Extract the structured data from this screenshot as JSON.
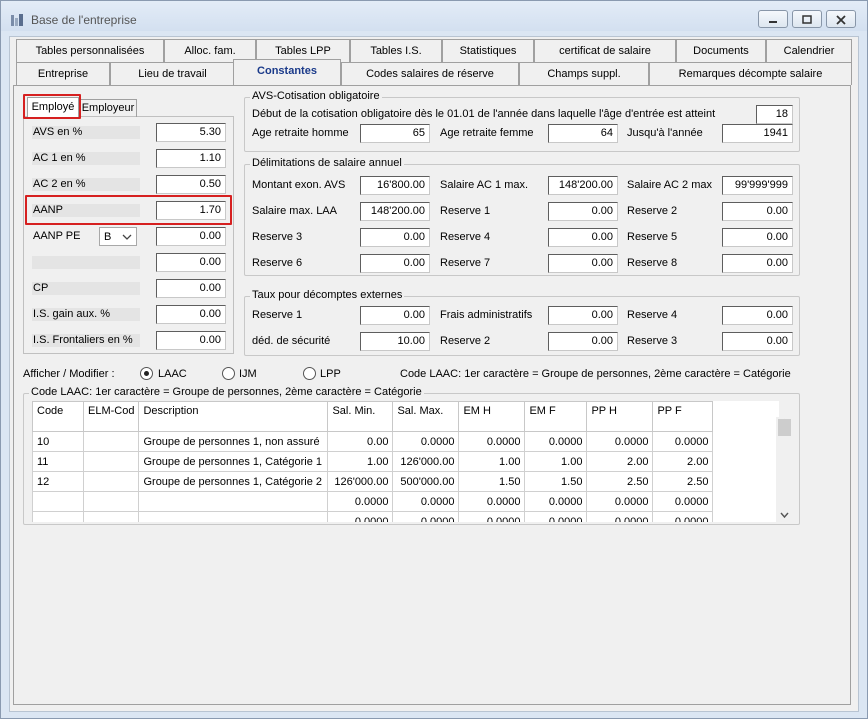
{
  "window": {
    "title": "Base de l'entreprise"
  },
  "tabs_row1": [
    "Tables personnalisées",
    "Alloc. fam.",
    "Tables LPP",
    "Tables I.S.",
    "Statistiques",
    "certificat de salaire",
    "Documents",
    "Calendrier"
  ],
  "tabs_row2": [
    "Entreprise",
    "Lieu de travail",
    "Constantes",
    "Codes salaires de réserve",
    "Champs suppl.",
    "Remarques décompte salaire"
  ],
  "subtabs": {
    "employe": "Employé",
    "employeur": "Employeur"
  },
  "left": {
    "avs_label": "AVS en %",
    "avs": "5.30",
    "ac1_label": "AC 1 en %",
    "ac1": "1.10",
    "ac2_label": "AC 2 en %",
    "ac2": "0.50",
    "aanp_label": "AANP",
    "aanp": "1.70",
    "aanppe_label": "AANP PE",
    "aanppe_select": "B",
    "aanppe": "0.00",
    "blank_value": "0.00",
    "cp_label": "CP",
    "cp": "0.00",
    "is_gain_label": "I.S. gain aux. %",
    "is_gain": "0.00",
    "is_front_label": "I.S. Frontaliers en %",
    "is_front": "0.00"
  },
  "avs_group": {
    "title": "AVS-Cotisation obligatoire",
    "debut_label": "Début de la cotisation obligatoire dès le 01.01 de l'année dans laquelle l'âge d'entrée est atteint",
    "debut": "18",
    "age_homme_label": "Age retraite homme",
    "age_homme": "65",
    "age_femme_label": "Age retraite femme",
    "age_femme": "64",
    "jusqu_label": "Jusqu'à l'année",
    "jusqu": "1941"
  },
  "delim_group": {
    "title": "Délimitations de salaire annuel",
    "montant_exon_label": "Montant exon. AVS",
    "montant_exon": "16'800.00",
    "sal_ac1_label": "Salaire AC 1 max.",
    "sal_ac1": "148'200.00",
    "sal_ac2_label": "Salaire AC 2 max",
    "sal_ac2": "99'999'999",
    "sal_laa_label": "Salaire max. LAA",
    "sal_laa": "148'200.00",
    "r1_label": "Reserve 1",
    "r1": "0.00",
    "r2_label": "Reserve 2",
    "r2": "0.00",
    "r3_label": "Reserve 3",
    "r3": "0.00",
    "r4_label": "Reserve 4",
    "r4": "0.00",
    "r5_label": "Reserve 5",
    "r5": "0.00",
    "r6_label": "Reserve 6",
    "r6": "0.00",
    "r7_label": "Reserve 7",
    "r7": "0.00",
    "r8_label": "Reserve 8",
    "r8": "0.00"
  },
  "taux_group": {
    "title": "Taux pour décomptes externes",
    "r1_label": "Reserve 1",
    "r1": "0.00",
    "frais_label": "Frais administratifs",
    "frais": "0.00",
    "r4_label": "Reserve 4",
    "r4": "0.00",
    "ded_label": "déd. de sécurité",
    "ded": "10.00",
    "r2_label": "Reserve 2",
    "r2": "0.00",
    "r3_label": "Reserve 3",
    "r3": "0.00"
  },
  "afficher": {
    "label": "Afficher / Modifier :",
    "opt_laac": "LAAC",
    "opt_ijm": "IJM",
    "opt_lpp": "LPP",
    "hint": "Code LAAC: 1er caractère = Groupe de personnes, 2ème caractère = Catégorie"
  },
  "table_group": {
    "title": "Code LAAC: 1er caractère = Groupe de personnes, 2ème caractère = Catégorie"
  },
  "table": {
    "headers": [
      "Code",
      "ELM-Cod",
      "Description",
      "Sal. Min.",
      "Sal. Max.",
      "EM H",
      "EM F",
      "PP H",
      "PP F"
    ],
    "rows": [
      [
        "10",
        "",
        "Groupe de personnes 1, non assuré",
        "0.00",
        "0.0000",
        "0.0000",
        "0.0000",
        "0.0000",
        "0.0000"
      ],
      [
        "11",
        "",
        "Groupe de personnes 1, Catégorie 1",
        "1.00",
        "126'000.00",
        "1.00",
        "1.00",
        "2.00",
        "2.00"
      ],
      [
        "12",
        "",
        "Groupe de personnes 1, Catégorie 2",
        "126'000.00",
        "500'000.00",
        "1.50",
        "1.50",
        "2.50",
        "2.50"
      ],
      [
        "",
        "",
        "",
        "0.0000",
        "0.0000",
        "0.0000",
        "0.0000",
        "0.0000",
        "0.0000"
      ],
      [
        "",
        "",
        "",
        "0.0000",
        "0.0000",
        "0.0000",
        "0.0000",
        "0.0000",
        "0.0000"
      ]
    ]
  }
}
